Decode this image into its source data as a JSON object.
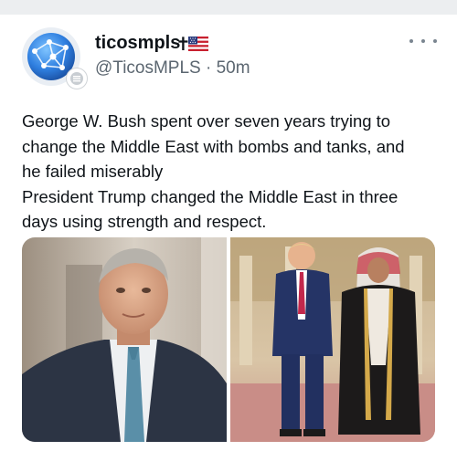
{
  "tweet": {
    "display_name": "ticosmpls",
    "name_symbol": "✝",
    "flag_icon": "us-flag-icon",
    "handle": "@TicosMPLS",
    "separator": "·",
    "time": "50m",
    "text_lines": [
      "George W. Bush spent over seven years trying to",
      "change the Middle East with bombs and tanks, and",
      "he failed miserably",
      "President Trump changed the Middle East in three",
      "days using strength and respect."
    ],
    "more_icon": "more-options-icon",
    "avatar_icon": "network-globe-icon",
    "badge_icon": "verified-badge-icon"
  },
  "colors": {
    "text": "#0f1419",
    "secondary_text": "#5b6670",
    "avatar_blue": "#2f7fe0"
  }
}
